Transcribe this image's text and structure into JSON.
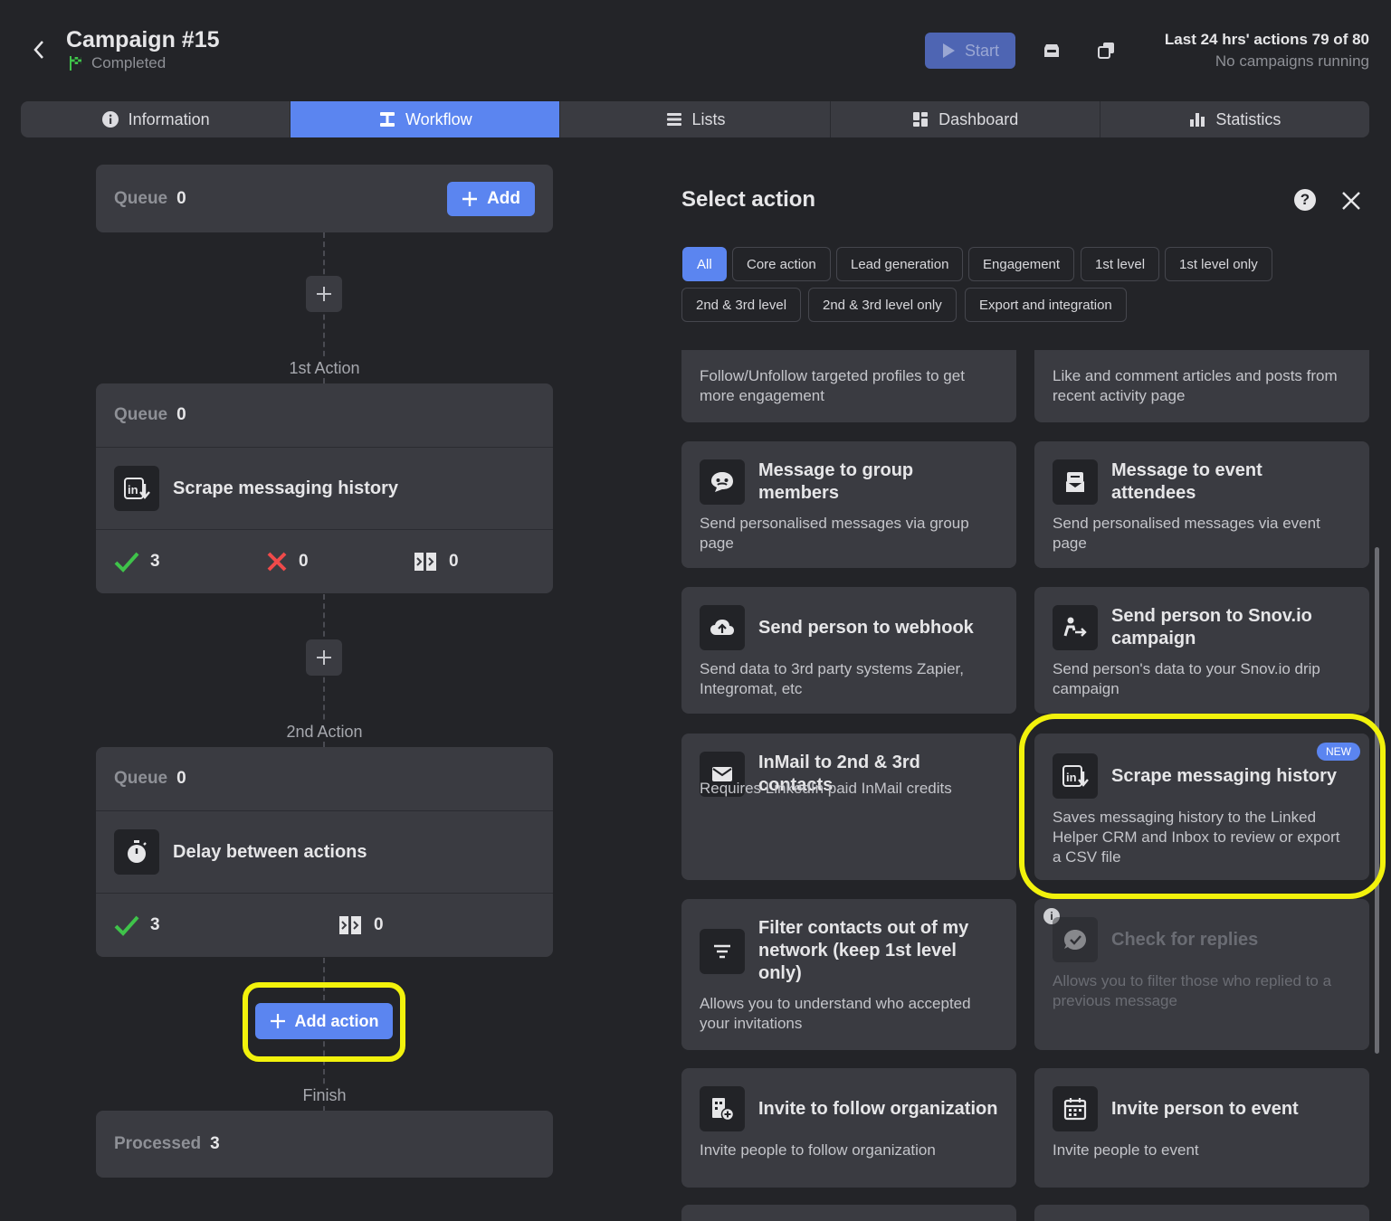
{
  "header": {
    "title": "Campaign #15",
    "status": "Completed",
    "start_label": "Start",
    "limits_line1": "Last 24 hrs' actions 79 of 80",
    "limits_line2": "No campaigns running"
  },
  "tabs": [
    {
      "label": "Information",
      "icon": "info-icon"
    },
    {
      "label": "Workflow",
      "icon": "workflow-icon",
      "active": true
    },
    {
      "label": "Lists",
      "icon": "list-icon"
    },
    {
      "label": "Dashboard",
      "icon": "dashboard-icon"
    },
    {
      "label": "Statistics",
      "icon": "bar-chart-icon"
    }
  ],
  "workflow": {
    "start": {
      "queue_label": "Queue",
      "queue_value": "0",
      "add_label": "Add"
    },
    "actions": [
      {
        "step_label": "1st Action",
        "queue_label": "Queue",
        "queue_value": "0",
        "name": "Scrape messaging history",
        "success": "3",
        "failed": "0",
        "skipped": "0"
      },
      {
        "step_label": "2nd Action",
        "queue_label": "Queue",
        "queue_value": "0",
        "name": "Delay between actions",
        "success": "3",
        "skipped": "0"
      }
    ],
    "add_action_label": "Add action",
    "finish": {
      "label": "Finish",
      "processed_label": "Processed",
      "processed_value": "3"
    }
  },
  "panel": {
    "title": "Select action",
    "filters": [
      "All",
      "Core action",
      "Lead generation",
      "Engagement",
      "1st level",
      "1st level only",
      "2nd & 3rd level",
      "2nd & 3rd level only",
      "Export and integration"
    ],
    "cards": [
      {
        "title": "",
        "desc": "Follow/Unfollow targeted profiles to get more engagement"
      },
      {
        "title": "",
        "desc": "Like and comment articles and posts from recent activity page"
      },
      {
        "title": "Message to group members",
        "desc": "Send personalised messages via group page",
        "icon": "group-chat-icon"
      },
      {
        "title": "Message to event attendees",
        "desc": "Send personalised messages via event page",
        "icon": "event-message-icon"
      },
      {
        "title": "Send person to webhook",
        "desc": "Send data to 3rd party systems Zapier, Integromat, etc",
        "icon": "cloud-upload-icon"
      },
      {
        "title": "Send person to Snov.io campaign",
        "desc": "Send person's data to your Snov.io drip campaign",
        "icon": "person-send-icon"
      },
      {
        "title": "InMail to 2nd & 3rd contacts",
        "desc": "Requires LinkedIn paid InMail credits",
        "icon": "mail-icon"
      },
      {
        "title": "Scrape messaging history",
        "desc": "Saves messaging history to the Linked Helper CRM and Inbox to review or export a CSV file",
        "icon": "linkedin-download-icon",
        "badge": "NEW"
      },
      {
        "title": "Filter contacts out of my network (keep 1st level only)",
        "desc": "Allows you to understand who accepted your invitations",
        "icon": "filter-icon"
      },
      {
        "title": "Check for replies",
        "desc": "Allows you to filter those who replied to a previous message",
        "icon": "reply-check-icon",
        "disabled": true
      },
      {
        "title": "Invite to follow organization",
        "desc": "Invite people to follow organization",
        "icon": "organization-add-icon"
      },
      {
        "title": "Invite person to event",
        "desc": "Invite people to event",
        "icon": "calendar-icon"
      }
    ]
  },
  "colors": {
    "accent": "#5b85f0",
    "highlight": "#f2f20c",
    "success": "#3fc34a",
    "error": "#f04a4a"
  }
}
